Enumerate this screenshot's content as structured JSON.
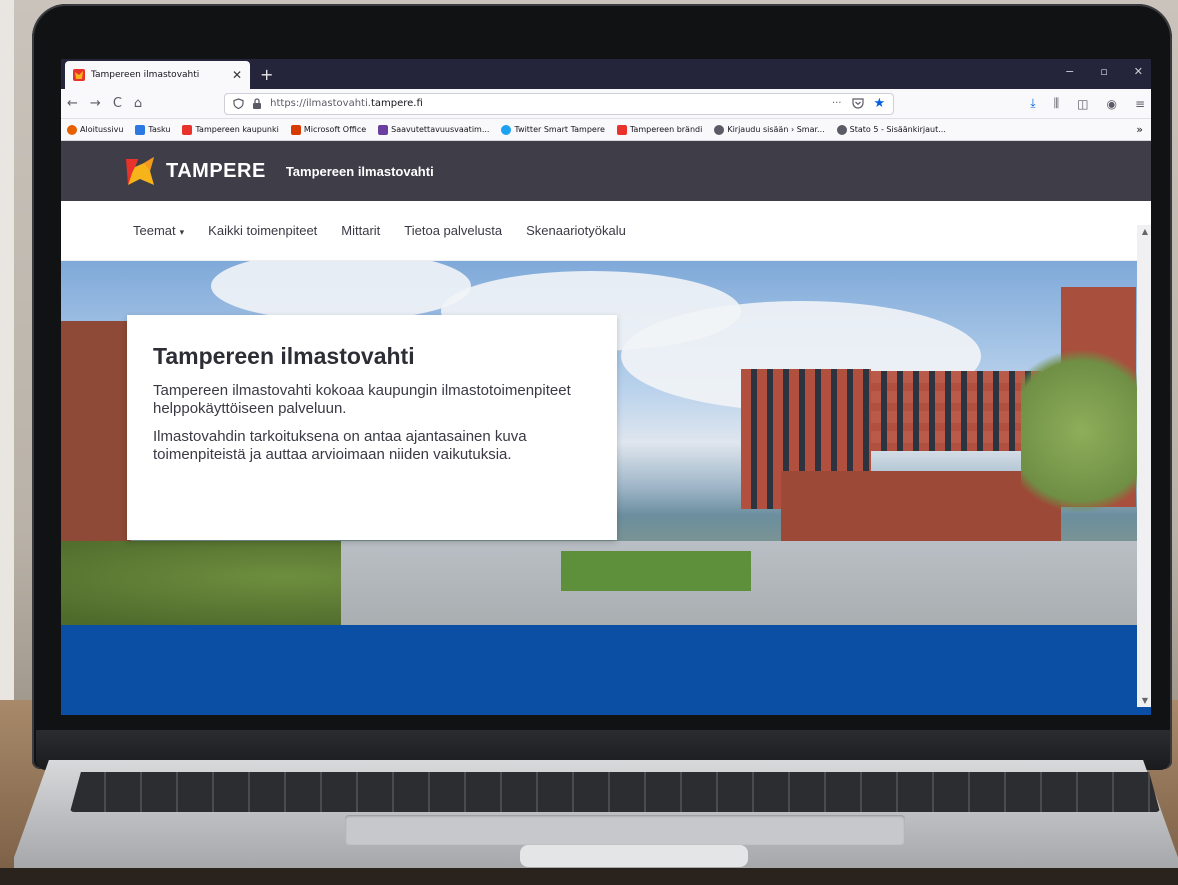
{
  "browser": {
    "tab_title": "Tampereen ilmastovahti",
    "tab_close": "✕",
    "new_tab": "+",
    "window_controls": [
      "−",
      "▫",
      "✕"
    ],
    "nav_back": "←",
    "nav_forward": "→",
    "nav_reload": "C",
    "nav_home": "⌂",
    "url_prefix": "https://ilmastovahti.",
    "url_domain": "tampere.fi",
    "url_more": "···",
    "bookmarks": [
      "Aloitussivu",
      "Tasku",
      "Tampereen kaupunki",
      "Microsoft Office",
      "Saavutettavuusvaatim...",
      "Twitter Smart Tampere",
      "Tampereen brändi",
      "Kirjaudu sisään › Smar...",
      "Stato 5 - Sisäänkirjaut..."
    ],
    "bookmarks_more": "»"
  },
  "site": {
    "brand": "TAMPERE",
    "site_name": "Tampereen ilmastovahti",
    "nav": [
      "Teemat",
      "Kaikki toimenpiteet",
      "Mittarit",
      "Tietoa palvelusta",
      "Skenaariotyökalu"
    ],
    "nav_caret": "▾"
  },
  "hero": {
    "title": "Tampereen ilmastovahti",
    "p1": "Tampereen ilmastovahti kokoaa kaupungin ilmastotoimenpiteet helppokäyttöiseen palveluun.",
    "p2": "Ilmastovahdin tarkoituksena on antaa ajantasainen kuva toimenpiteistä ja auttaa arvioimaan niiden vaikutuksia."
  },
  "colors": {
    "header_bg": "#3e3d48",
    "band_blue": "#0a4fa3",
    "tab_bar": "#24243a",
    "accent": "#0061e0"
  }
}
